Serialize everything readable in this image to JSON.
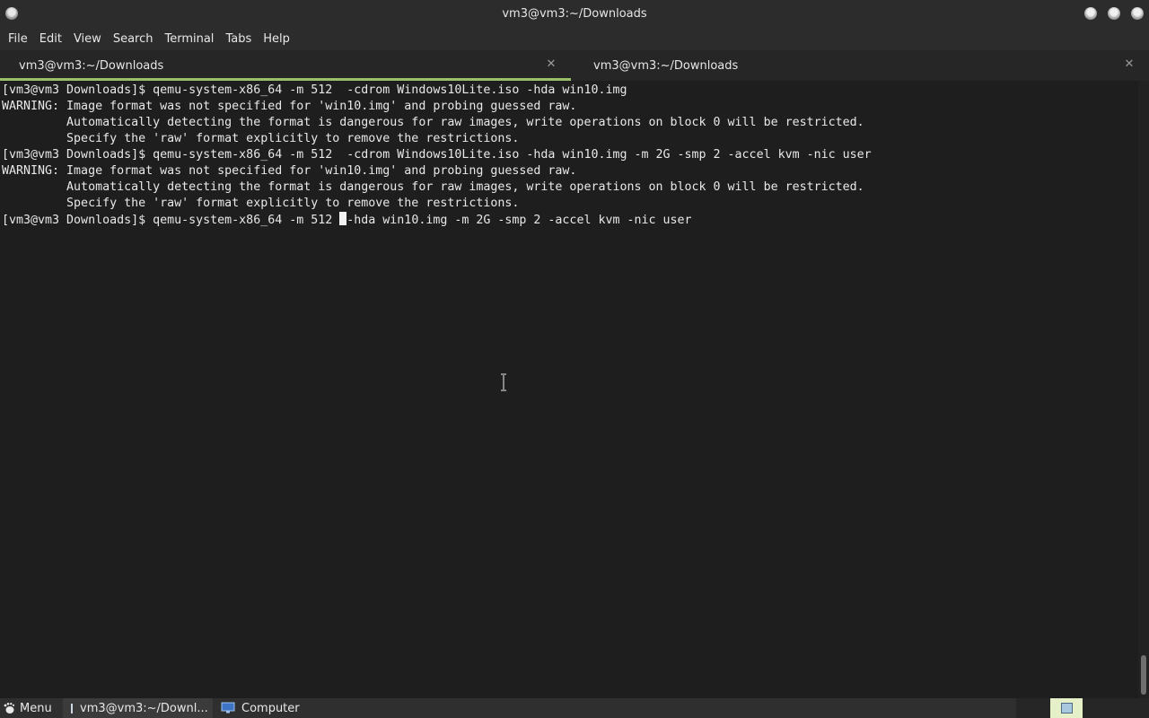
{
  "window": {
    "title": "vm3@vm3:~/Downloads"
  },
  "menubar": {
    "items": [
      "File",
      "Edit",
      "View",
      "Search",
      "Terminal",
      "Tabs",
      "Help"
    ]
  },
  "tabs": [
    {
      "label": "vm3@vm3:~/Downloads",
      "active": true,
      "close": "✕"
    },
    {
      "label": "vm3@vm3:~/Downloads",
      "active": false,
      "close": "✕"
    }
  ],
  "terminal": {
    "lines": [
      "[vm3@vm3 Downloads]$ qemu-system-x86_64 -m 512  -cdrom Windows10Lite.iso -hda win10.img",
      "WARNING: Image format was not specified for 'win10.img' and probing guessed raw.",
      "         Automatically detecting the format is dangerous for raw images, write operations on block 0 will be restricted.",
      "         Specify the 'raw' format explicitly to remove the restrictions.",
      "[vm3@vm3 Downloads]$ qemu-system-x86_64 -m 512  -cdrom Windows10Lite.iso -hda win10.img -m 2G -smp 2 -accel kvm -nic user",
      "WARNING: Image format was not specified for 'win10.img' and probing guessed raw.",
      "         Automatically detecting the format is dangerous for raw images, write operations on block 0 will be restricted.",
      "         Specify the 'raw' format explicitly to remove the restrictions."
    ],
    "current_prompt": "[vm3@vm3 Downloads]$ qemu-system-x86_64 -m 512 ",
    "current_after_cursor": "-hda win10.img -m 2G -smp 2 -accel kvm -nic user"
  },
  "taskbar": {
    "menu_label": "Menu",
    "tasks": [
      {
        "label": "vm3@vm3:~/Downl...",
        "icon": "terminal-icon"
      },
      {
        "label": "Computer",
        "icon": "computer-icon"
      }
    ]
  },
  "colors": {
    "background": "#1e1e1e",
    "text": "#e8e8e8",
    "tab_accent": "#9bbf6a"
  }
}
